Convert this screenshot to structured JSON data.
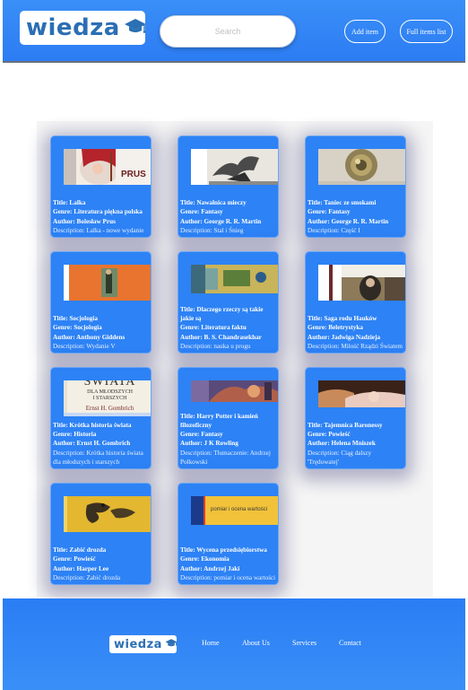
{
  "header": {
    "logo_text": "wiedza",
    "search_placeholder": "Search",
    "add_item_label": "Add item",
    "full_list_label": "Full items list"
  },
  "items": [
    {
      "title": "Title: Lalka",
      "genre": "Genre: Literatura piękna polska",
      "author": "Author: Bolesław Prus",
      "description": "Description: Lalka - nowe wydanie"
    },
    {
      "title": "Title: Nawałnica mieczy",
      "genre": "Genre: Fantasy",
      "author": "Author: George R. R. Martin",
      "description": "Description: Stal i Śnieg"
    },
    {
      "title": "Title: Taniec ze smokami",
      "genre": "Genre: Fantasy",
      "author": "Author: George R. R. Martin",
      "description": "Description: Część I"
    },
    {
      "title": "Title: Socjologia",
      "genre": "Genre: Socjologia",
      "author": "Author: Anthony Giddens",
      "description": "Description: Wydanie V"
    },
    {
      "title": "Title: Dlaczego rzeczy są takie jakie są",
      "genre": "Genre: Literatura faktu",
      "author": "Author: B. S. Chandrasekhar",
      "description": "Description: nauka u progu"
    },
    {
      "title": "Title: Saga rodu Hauków",
      "genre": "Genre: Beletrystyka",
      "author": "Author: Jadwiga Nadzieja",
      "description": "Description: Miłość Rządzi Światem"
    },
    {
      "title": "Title: Krótka historia świata",
      "genre": "Genre: Historia",
      "author": "Author: Ernst H. Gombrich",
      "description": "Description: Krótka historia świata dla młodszych i starszych"
    },
    {
      "title": "Title: Harry Potter i kamień filozoficzny",
      "genre": "Genre: Fantasy",
      "author": "Author: J K Rowling",
      "description": "Description: Tłumaczenie: Andrzej Polkowski"
    },
    {
      "title": "Title: Tajemnica Baronessy",
      "genre": "Genre: Powieść",
      "author": "Author: Helena Mniszek",
      "description": "Description: Ciąg dalszy 'Trędowatej'"
    },
    {
      "title": "Title: Zabić drozda",
      "genre": "Genre: Powieść",
      "author": "Author: Harper Lee",
      "description": "Description: Zabić drozda"
    },
    {
      "title": "Title: Wycena przedsiębiorstwa",
      "genre": "Genre: Ekonomia",
      "author": "Author: Andrzej Jaki",
      "description": "Description: pomiar i ocena wartości"
    }
  ],
  "cover_text": {
    "prus": "PRUS",
    "swiata_title": "ŚWIATA",
    "swiata_sub1": "DLA MŁODSZYCH",
    "swiata_sub2": "I STARSZYCH",
    "swiata_author": "Ernst H. Gombrich",
    "wycena": "pomiar i ocena wartości"
  },
  "footer": {
    "logo_text": "wiedza",
    "nav": [
      "Home",
      "About Us",
      "Services",
      "Contact"
    ]
  },
  "colors": {
    "header_blue": "#3a8ff7",
    "card_blue": "#2d82f5",
    "logo_text": "#2b6fb4"
  }
}
